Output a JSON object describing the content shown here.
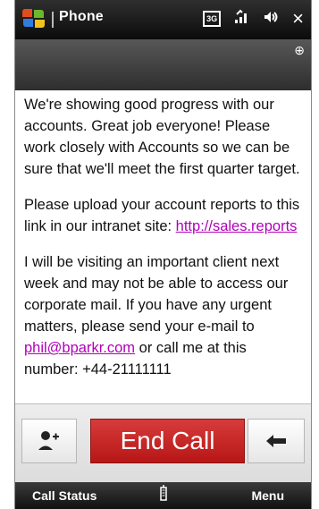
{
  "app": {
    "title": "Phone"
  },
  "status_icons": {
    "data": "3G",
    "signal": "signal-icon",
    "volume": "volume-icon",
    "close": "close-icon",
    "message": "message-icon"
  },
  "message": {
    "paragraphs": [
      {
        "text": "We're showing good progress with our accounts. Great job everyone! Please work closely with Accounts so we can be sure that we'll meet the first quarter target."
      },
      {
        "text_before": "Please upload your account reports to this link in our intranet site: ",
        "link": "http://sales.reports"
      },
      {
        "text_before": "I will be visiting an important client next week and may not be able to access our corporate mail. If you have any urgent matters, please send your e-mail to ",
        "email": "phil@bparkr.com",
        "text_after": " or call me at this number: +44-21111111"
      }
    ]
  },
  "controls": {
    "left_button_icon": "contact-icon",
    "end_call_label": "End Call",
    "right_button_icon": "back-arrow-icon"
  },
  "softkeys": {
    "left": "Call Status",
    "right": "Menu",
    "center_icon": "keyboard-icon"
  }
}
